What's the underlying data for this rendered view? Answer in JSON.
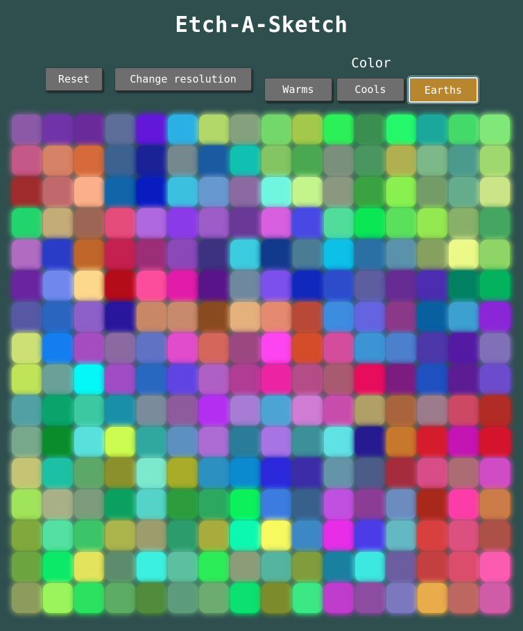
{
  "app": {
    "title": "Etch-A-Sketch"
  },
  "controls": {
    "reset_label": "Reset",
    "resolution_label": "Change resolution",
    "color_heading": "Color",
    "palettes": [
      {
        "label": "Warms",
        "active": false
      },
      {
        "label": "Cools",
        "active": false
      },
      {
        "label": "Earths",
        "active": true,
        "color": "#b8862e"
      }
    ]
  },
  "grid": {
    "columns": 16,
    "rows": 16,
    "cells": [
      [
        "#8a5aa6",
        "#7034a8",
        "#6a2b9a",
        "#5d6e98",
        "#6317d8",
        "#2ab0e4",
        "#b3d86a",
        "#84a07c",
        "#72d86a",
        "#a4c84a",
        "#2cf058",
        "#3a8e50",
        "#24f86a",
        "#1aa89c",
        "#44da6a",
        "#80e878"
      ],
      [
        "#c45888",
        "#d68266",
        "#d66a3a",
        "#3e6290",
        "#1a2296",
        "#74888e",
        "#1a5aa0",
        "#10c0b0",
        "#84c462",
        "#4aa850",
        "#7a907c",
        "#4a9660",
        "#b0b050",
        "#7cb888",
        "#4c9a8c",
        "#a0d870"
      ],
      [
        "#9e2c2c",
        "#c0686c",
        "#fcb08a",
        "#1066a8",
        "#081cc0",
        "#3cc0e0",
        "#6898d0",
        "#8a6aa0",
        "#70f6e0",
        "#c4f48c",
        "#8a9880",
        "#3aa240",
        "#8af050",
        "#749c68",
        "#64ac8c",
        "#cce488"
      ],
      [
        "#22d46c",
        "#c4ac78",
        "#9c6654",
        "#e44c7c",
        "#b068de",
        "#8a3ae8",
        "#9e5cc8",
        "#6a3896",
        "#d860e0",
        "#4848e4",
        "#52dc9c",
        "#0ae654",
        "#5ae05a",
        "#94e850",
        "#88b068",
        "#44a660"
      ],
      [
        "#b06cc0",
        "#283cc8",
        "#c0662a",
        "#c42050",
        "#9c2e78",
        "#8a48b8",
        "#3c3280",
        "#3ccce0",
        "#123a8c",
        "#4a7c96",
        "#0cc0e8",
        "#2a70a4",
        "#5a92ac",
        "#86a060",
        "#ecf888",
        "#8ed466"
      ],
      [
        "#6a24a0",
        "#7088ee",
        "#fcd88c",
        "#b40c18",
        "#fc4c9c",
        "#e01ca8",
        "#581488",
        "#6e88a0",
        "#7c50ec",
        "#1028bc",
        "#2c4ccc",
        "#5c5ea0",
        "#662c94",
        "#4c2cb0",
        "#028062",
        "#04b25e"
      ],
      [
        "#5658a4",
        "#2a66c0",
        "#8c60c8",
        "#28169c",
        "#c88866",
        "#c88a6c",
        "#8a4a20",
        "#e4b07c",
        "#e48a70",
        "#b84838",
        "#3c8ce0",
        "#6464e0",
        "#8c3888",
        "#0860a0",
        "#3ca0d0",
        "#8a26d8"
      ],
      [
        "#cce076",
        "#127ef0",
        "#a44cc0",
        "#8a6aa0",
        "#6072c4",
        "#e04ccc",
        "#d4665c",
        "#9c4880",
        "#fc44f0",
        "#d44c28",
        "#d44c9c",
        "#3c94d4",
        "#4c80cc",
        "#4c38a8",
        "#541aa4",
        "#8070b8"
      ],
      [
        "#c0e458",
        "#6aa098",
        "#04f8f8",
        "#a04cc4",
        "#2868c0",
        "#6044e4",
        "#b060c4",
        "#b03c94",
        "#ec24a4",
        "#b44c88",
        "#a85a70",
        "#e80c5c",
        "#7c1c80",
        "#1e50c0",
        "#5c1c94",
        "#6c4ccc"
      ],
      [
        "#52a0a4",
        "#08a46c",
        "#3cc8a0",
        "#1a90a8",
        "#7a8c9c",
        "#8e5c9c",
        "#b32ef0",
        "#a87cd4",
        "#4ca4d4",
        "#d07cd4",
        "#c84cac",
        "#b0a068",
        "#a8643c",
        "#9c7c8c",
        "#cc4864",
        "#b02c24"
      ],
      [
        "#78a88c",
        "#0a8c2a",
        "#58e0dc",
        "#ccfc50",
        "#30a8a0",
        "#5c90c0",
        "#ac6cd4",
        "#2a7c98",
        "#a874e4",
        "#3c9098",
        "#60e2e4",
        "#261a90",
        "#c8782c",
        "#d41c2c",
        "#c414b4",
        "#d4142c"
      ],
      [
        "#c4c474",
        "#1cc0a4",
        "#5ca868",
        "#8c902c",
        "#7ce8cc",
        "#a8ac28",
        "#2c90c0",
        "#0c8ad0",
        "#2c28dc",
        "#3c2ca8",
        "#6494a8",
        "#4c5c88",
        "#a42c3c",
        "#d84c88",
        "#ac6c74",
        "#d04cc4"
      ],
      [
        "#a0e45c",
        "#a8b088",
        "#7c9c7c",
        "#0ca060",
        "#54d4c8",
        "#2c9c3c",
        "#2ca860",
        "#0cf05c",
        "#3c7ce0",
        "#38608c",
        "#c050e0",
        "#8c3c94",
        "#6c8cc0",
        "#a8281c",
        "#fc3ca8",
        "#cc7c48"
      ],
      [
        "#80a83c",
        "#54e0a0",
        "#3cc468",
        "#acb44c",
        "#9c9c6c",
        "#2c9c6c",
        "#a8ac3c",
        "#0cf8b0",
        "#f8f860",
        "#3c88c4",
        "#e82ce8",
        "#4c3ce8",
        "#64b8c4",
        "#d84040",
        "#dc5080",
        "#ac5048"
      ],
      [
        "#6ca440",
        "#0ce868",
        "#e4e45c",
        "#5c8c6c",
        "#3cf0e0",
        "#5cc0a0",
        "#2cec58",
        "#8c9c78",
        "#54b4a0",
        "#809c3c",
        "#1a80a0",
        "#3ce8e0",
        "#6c5ca0",
        "#c44040",
        "#dc4c6c",
        "#fc5cb0"
      ],
      [
        "#8c9c5c",
        "#9cf45c",
        "#2ce060",
        "#5cac64",
        "#508c3c",
        "#5c9c7c",
        "#6cac70",
        "#0ce070",
        "#7c8c2c",
        "#3ce884",
        "#c03ccc",
        "#8c4ca0",
        "#7c78c0",
        "#e8ac4c",
        "#bc6860",
        "#d05ca8"
      ]
    ]
  }
}
